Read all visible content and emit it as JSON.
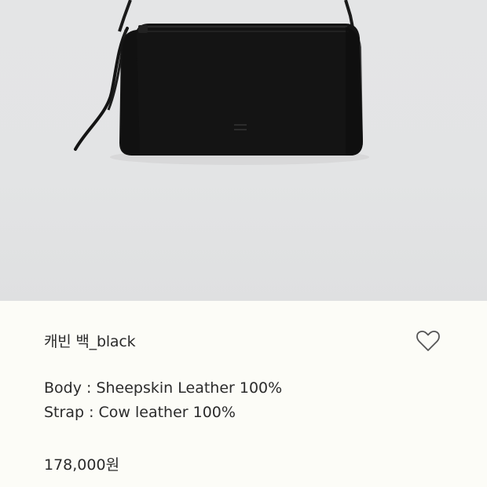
{
  "product": {
    "name": "캐빈 백_black",
    "image_icon": "black-shoulder-bag-photo"
  },
  "wishlist": {
    "icon": "heart-outline-icon"
  },
  "specs": {
    "body": "Body : Sheepskin Leather 100%",
    "strap": "Strap : Cow leather 100%"
  },
  "price": "178,000원",
  "colors": {
    "photo_background": "#e3e4e5",
    "info_background": "#fcfcf7",
    "text": "#2b2b2b",
    "bag": "#141414"
  }
}
